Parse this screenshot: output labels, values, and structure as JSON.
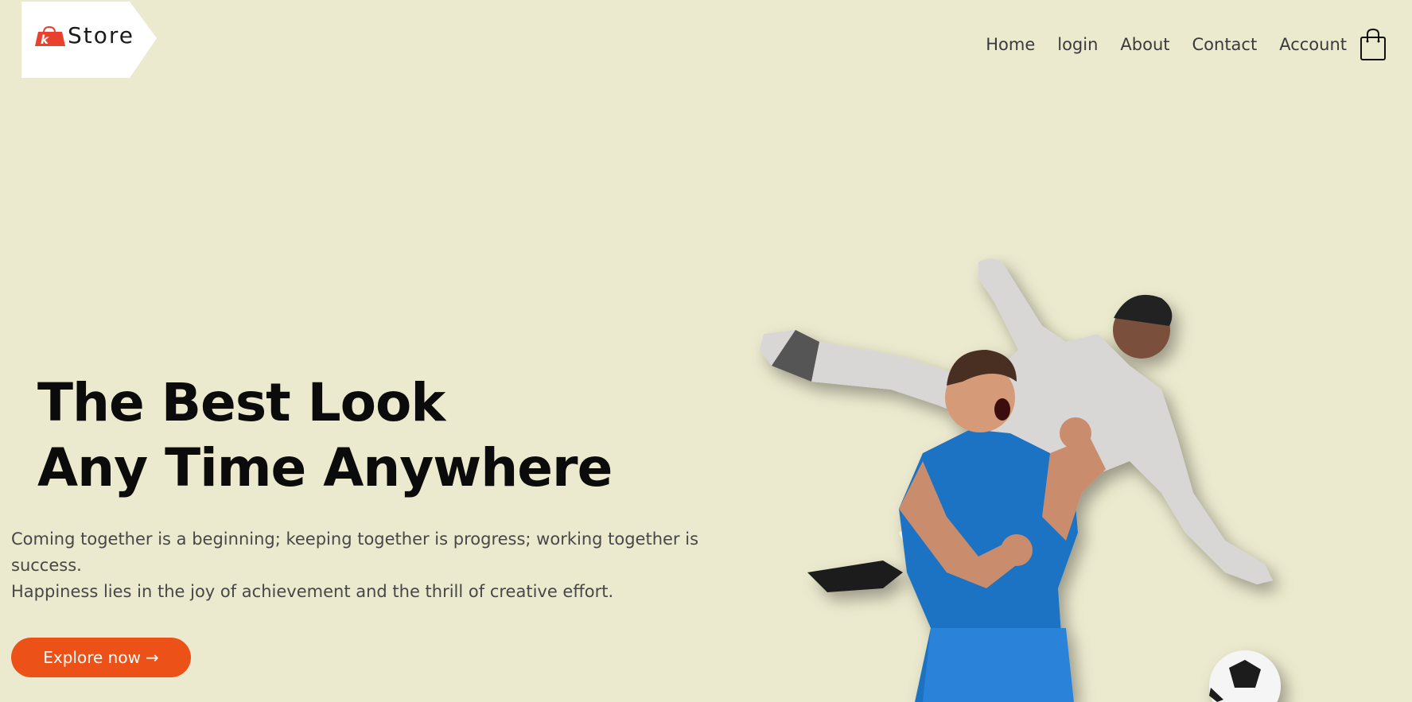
{
  "brand": {
    "logo_text": "Store",
    "logo_mark": "k"
  },
  "nav": {
    "items": [
      "Home",
      "login",
      "About",
      "Contact",
      "Account"
    ],
    "cart_icon": "shopping-bag-icon"
  },
  "hero": {
    "title_line1": "The Best Look",
    "title_line2": "Any Time Anywhere",
    "description_line1": "Coming together is a beginning; keeping together is progress; working together is success.",
    "description_line2": "Happiness lies in the joy of achievement and the thrill of creative effort.",
    "cta_label": "Explore now",
    "cta_arrow": "→"
  },
  "colors": {
    "background": "#eceace",
    "accent": "#ec5118",
    "logo_red": "#e8412e",
    "player_blue": "#1f73c4"
  }
}
